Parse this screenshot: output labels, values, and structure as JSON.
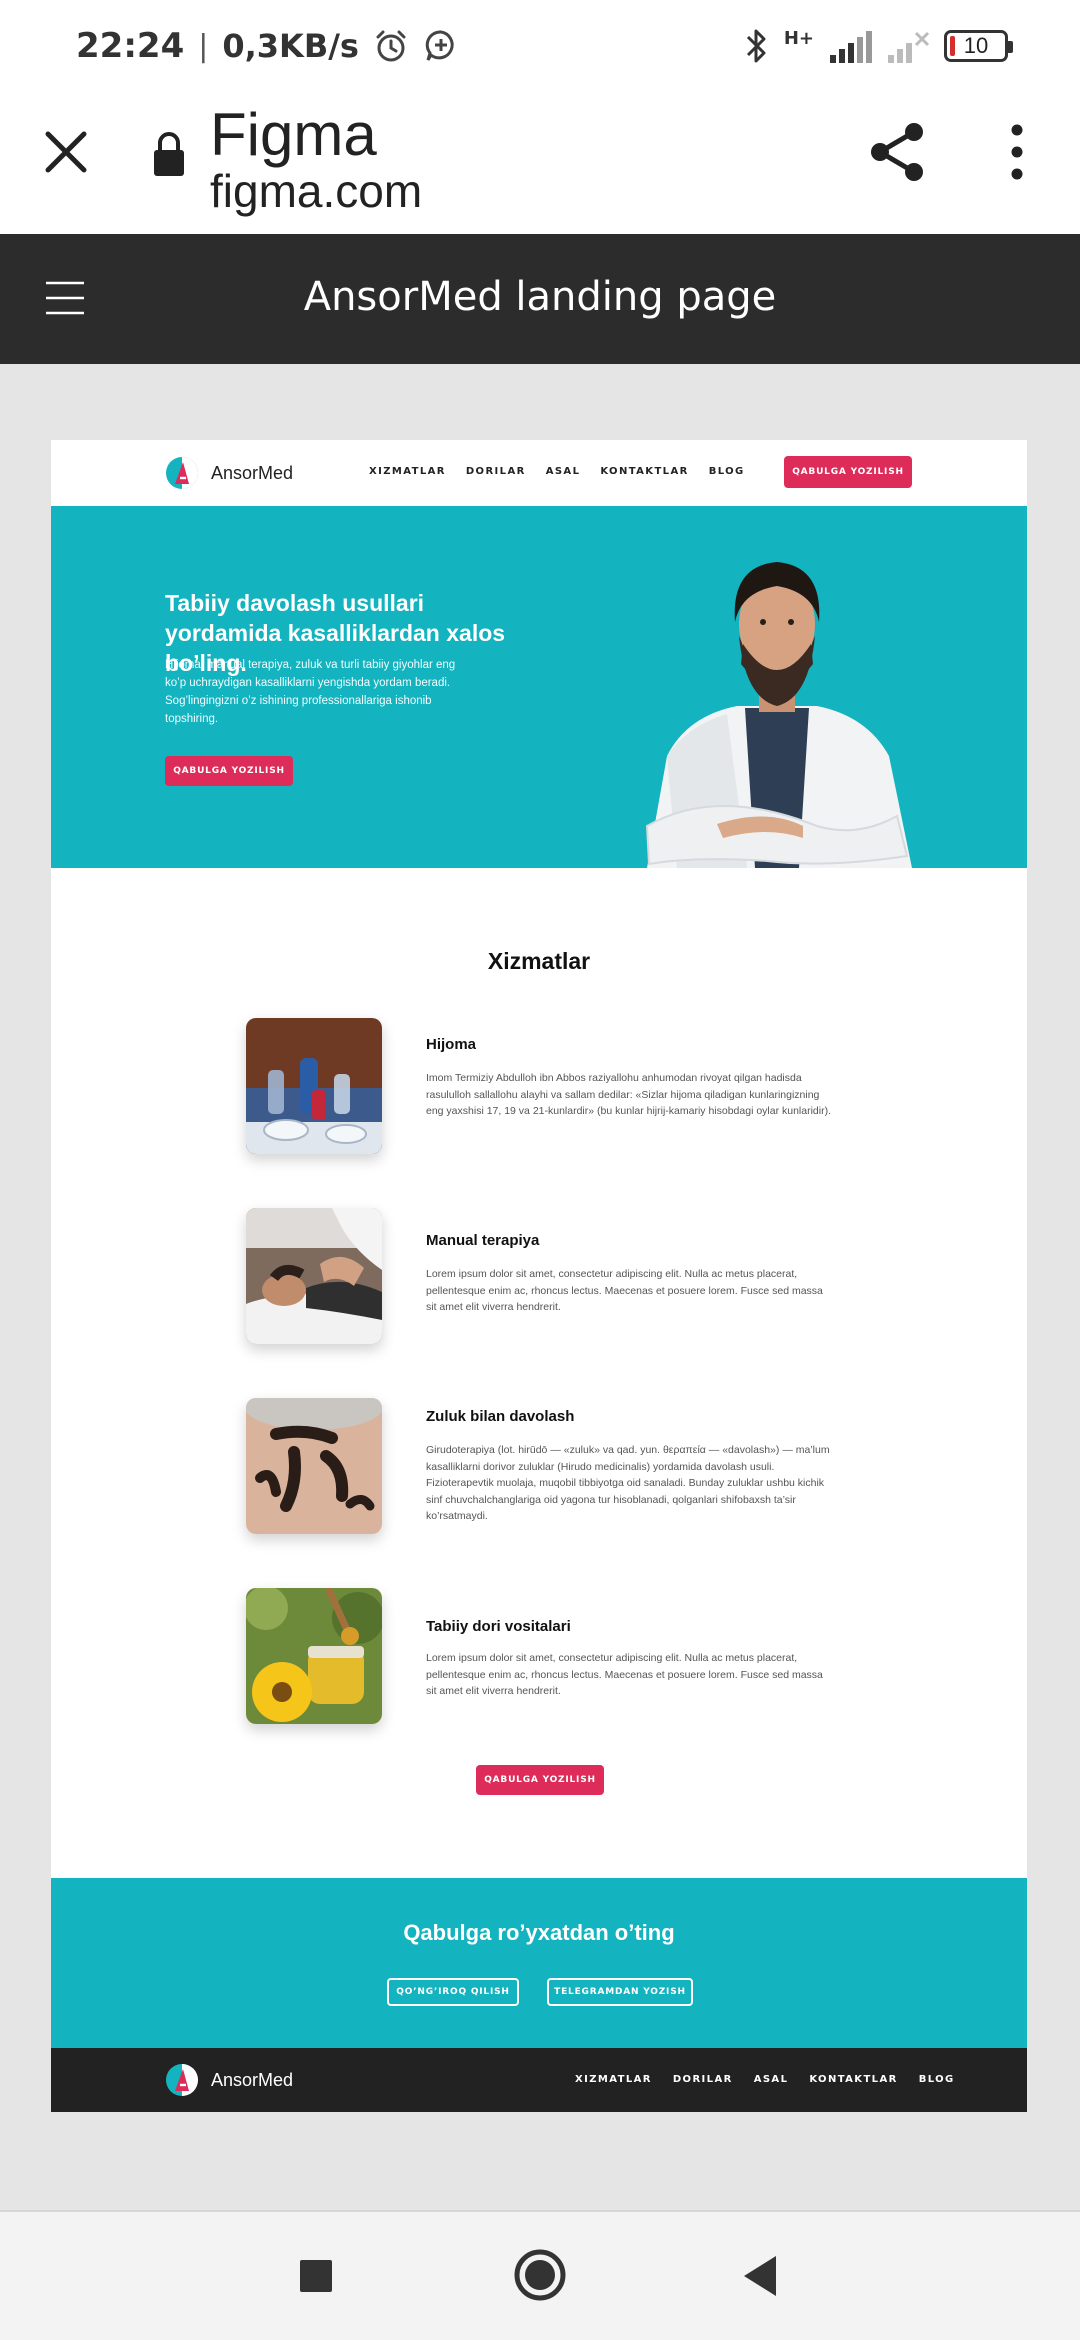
{
  "status_bar": {
    "time": "22:24",
    "separator": "|",
    "speed": "0,3KB/s",
    "network": "H+",
    "battery": "10",
    "icons": [
      "alarm-icon",
      "chat-bubble-plus-icon",
      "bluetooth-icon",
      "signal-icon",
      "signal-no-service-icon",
      "battery-icon"
    ]
  },
  "browser": {
    "title": "Figma",
    "url": "figma.com",
    "icons": [
      "close-icon",
      "lock-icon",
      "share-icon",
      "more-vert-icon"
    ]
  },
  "figma": {
    "file_title": "AnsorMed landing page",
    "icons": [
      "hamburger-menu-icon"
    ]
  },
  "landing": {
    "logo": "AnsorMed",
    "nav": [
      "XIZMATLAR",
      "DORILAR",
      "ASAL",
      "KONTAKTLAR",
      "BLOG"
    ],
    "cta": "QABULGA YOZILISH",
    "hero": {
      "title": "Tabiiy davolash usullari yordamida kasalliklardan xalos bo’ling.",
      "text": "Hijoma, manual terapiya, zuluk va turli tabiiy giyohlar eng ko’p uchraydigan kasalliklarni yengishda yordam beradi. Sog’lingingizni o’z ishining professionallariga ishonib topshiring.",
      "cta": "QABULGA YOZILISH"
    },
    "services": {
      "title": "Xizmatlar",
      "items": [
        {
          "name": "Hijoma",
          "desc": "Imom Termiziy Abdulloh ibn Abbos raziyallohu anhumodan rivoyat qilgan hadisda rasululloh sallallohu alayhi va sallam dedilar: «Sizlar hijoma qiladigan kunlaringizning eng yaxshisi 17, 19 va 21-kunlardir» (bu kunlar hijrij-kamariy hisobdagi oylar kunlaridir)."
        },
        {
          "name": "Manual terapiya",
          "desc": "Lorem ipsum dolor sit amet, consectetur adipiscing elit. Nulla ac metus placerat, pellentesque enim ac, rhoncus lectus. Maecenas et posuere lorem. Fusce sed massa sit amet elit viverra hendrerit."
        },
        {
          "name": "Zuluk bilan davolash",
          "desc": "Girudoterapiya (lot. hirūdō — «zuluk» va qad. yun. θεραπεία — «davolash») — ma’lum kasalliklarni dorivor zuluklar (Hirudo medicinalis) yordamida davolash usuli. Fizioterapevtik muolaja, muqobil tibbiyotga oid sanaladi. Bunday zuluklar ushbu kichik sinf chuvchalchanglariga oid yagona tur hisoblanadi, qolganlari shifobaxsh ta’sir ko’rsatmaydi."
        },
        {
          "name": "Tabiiy dori vositalari",
          "desc": "Lorem ipsum dolor sit amet, consectetur adipiscing elit. Nulla ac metus placerat, pellentesque enim ac, rhoncus lectus. Maecenas et posuere lorem. Fusce sed massa sit amet elit viverra hendrerit."
        }
      ],
      "cta": "QABULGA YOZILISH"
    },
    "register": {
      "title": "Qabulga ro’yxatdan o’ting",
      "call_btn": "QO’NG’IROQ QILISH",
      "telegram_btn": "TELEGRAMDAN YOZISH"
    },
    "footer": {
      "logo": "AnsorMed",
      "nav": [
        "XIZMATLAR",
        "DORILAR",
        "ASAL",
        "KONTAKTLAR",
        "BLOG"
      ]
    },
    "colors": {
      "teal": "#13b3bf",
      "red": "#dd2c5a",
      "dark": "#222222"
    }
  },
  "system_nav": {
    "icons": [
      "recents-square-icon",
      "home-circle-icon",
      "back-triangle-icon"
    ]
  }
}
